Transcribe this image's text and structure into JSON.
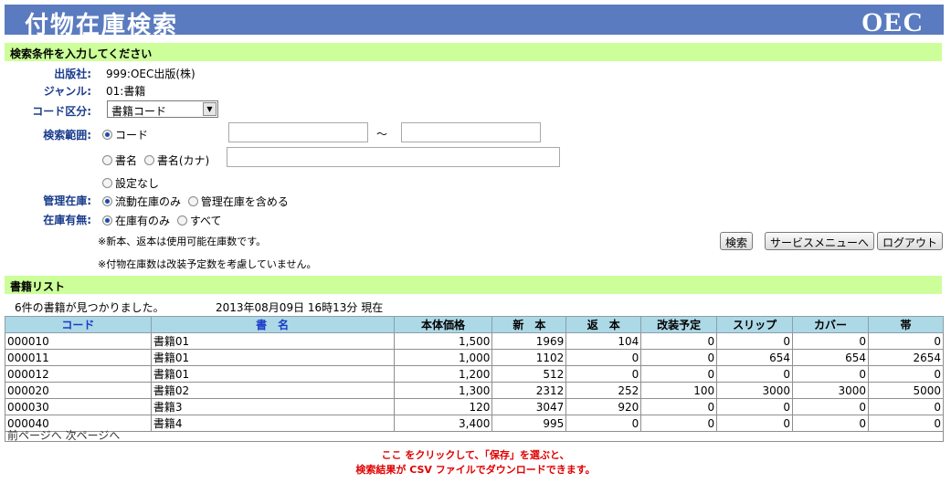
{
  "header": {
    "title": "付物在庫検索",
    "logo": "OEC"
  },
  "search_section": {
    "heading": "検索条件を入力してください",
    "publisher_label": "出版社:",
    "publisher_value": "999:OEC出版(株)",
    "genre_label": "ジャンル:",
    "genre_value": "01:書籍",
    "code_type_label": "コード区分:",
    "code_type_selected": "書籍コード",
    "range_label": "検索範囲:",
    "range_option_code": "コード",
    "tilde": "～",
    "range_from_value": "",
    "range_to_value": "",
    "range_option_title": "書名",
    "range_option_kana": "書名(カナ)",
    "title_value": "",
    "range_option_none": "設定なし",
    "stock_mgmt_label": "管理在庫:",
    "stock_mgmt_opt1": "流動在庫のみ",
    "stock_mgmt_opt2": "管理在庫を含める",
    "stock_exist_label": "在庫有無:",
    "stock_exist_opt1": "在庫有のみ",
    "stock_exist_opt2": "すべて",
    "note1": "※新本、返本は使用可能在庫数です。",
    "note2": "※付物在庫数は改装予定数を考慮していません。",
    "buttons": {
      "search": "検索",
      "service_menu": "サービスメニューへ",
      "logout": "ログアウト"
    }
  },
  "list_section": {
    "heading": "書籍リスト",
    "result_count": "6件の書籍が見つかりました。",
    "timestamp": "2013年08月09日 16時13分 現在",
    "columns": [
      "コード",
      "書　名",
      "本体価格",
      "新　本",
      "返　本",
      "改装予定",
      "スリップ",
      "カバー",
      "帯"
    ],
    "rows": [
      [
        "000010",
        "書籍01",
        "1,500",
        "1969",
        "104",
        "0",
        "0",
        "0",
        "0"
      ],
      [
        "000011",
        "書籍01",
        "1,000",
        "1102",
        "0",
        "0",
        "654",
        "654",
        "2654"
      ],
      [
        "000012",
        "書籍01",
        "1,200",
        "512",
        "0",
        "0",
        "0",
        "0",
        "0"
      ],
      [
        "000020",
        "書籍02",
        "1,300",
        "2312",
        "252",
        "100",
        "3000",
        "3000",
        "5000"
      ],
      [
        "000030",
        "書籍3",
        "120",
        "3047",
        "920",
        "0",
        "0",
        "0",
        "0"
      ],
      [
        "000040",
        "書籍4",
        "3,400",
        "995",
        "0",
        "0",
        "0",
        "0",
        "0"
      ]
    ],
    "pager": {
      "prev": "前ページへ",
      "next": "次ページへ"
    }
  },
  "footer_note": {
    "line1": "ここ をクリックして、「保存」を選ぶと、",
    "line2": "検索結果が CSV ファイルでダウンロードできます。"
  }
}
